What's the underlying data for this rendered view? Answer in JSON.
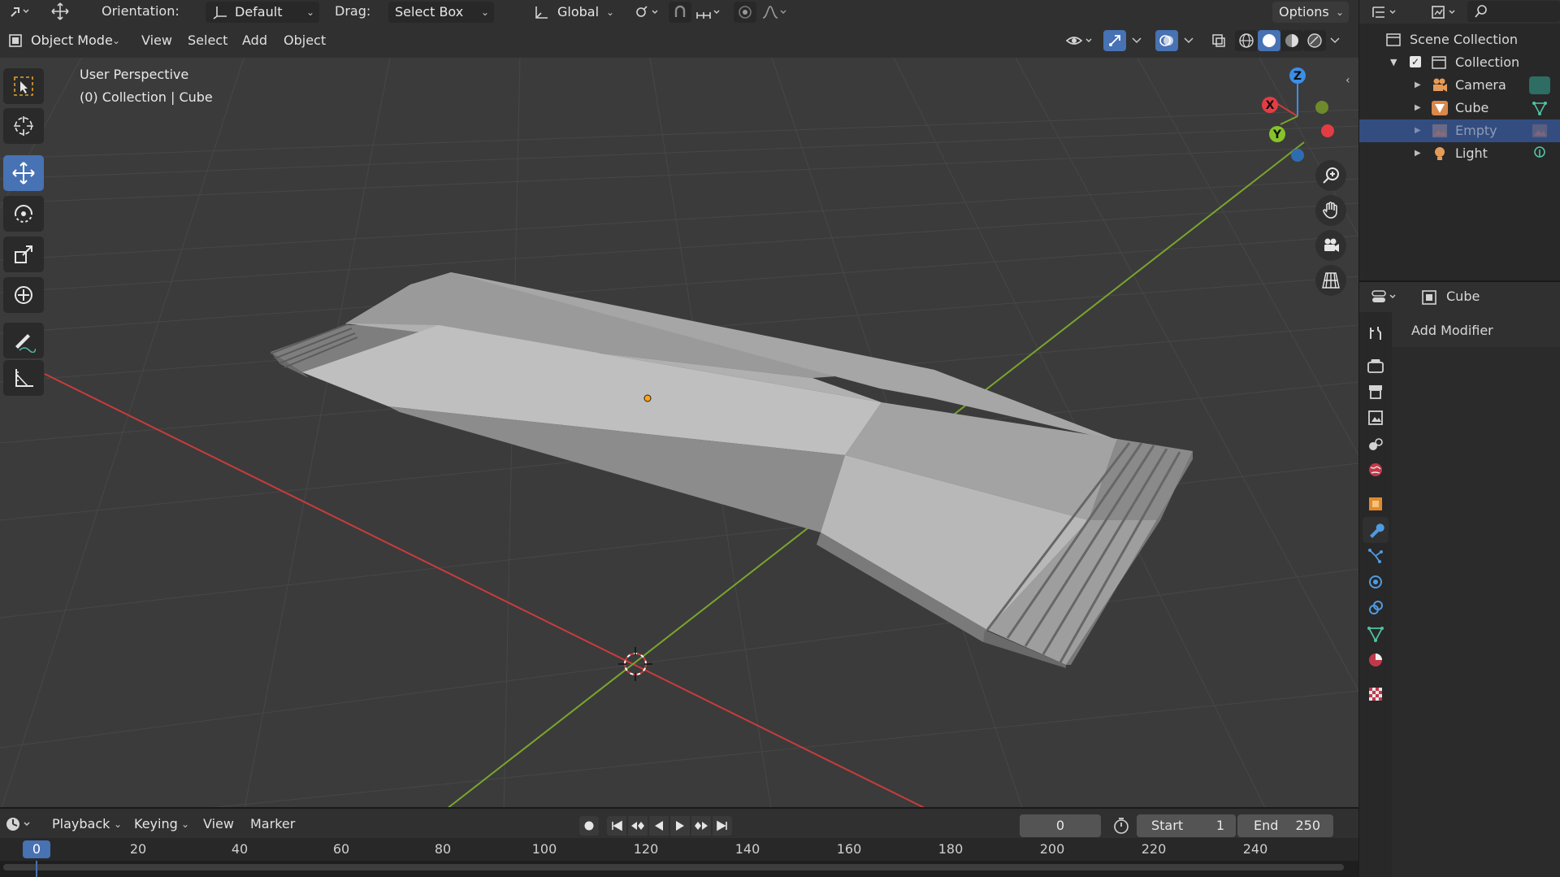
{
  "header": {
    "orientation_label": "Orientation:",
    "orientation_value": "Default",
    "drag_label": "Drag:",
    "drag_value": "Select Box",
    "transform_space": "Global",
    "options_label": "Options"
  },
  "viewport_header": {
    "mode": "Object Mode",
    "menus": [
      "View",
      "Select",
      "Add",
      "Object"
    ]
  },
  "viewport": {
    "perspective": "User Perspective",
    "context": "(0) Collection | Cube",
    "gizmo_axes": {
      "x": "X",
      "y": "Y",
      "z": "Z"
    },
    "colors": {
      "x_axis": "#c83c3c",
      "y_axis": "#7aa62e",
      "origin": "#ffa319"
    }
  },
  "toolbar": {
    "tools": [
      "select-box",
      "cursor",
      "move",
      "rotate",
      "scale",
      "transform",
      "annotate",
      "measure"
    ],
    "active": "move"
  },
  "outliner": {
    "root": "Scene Collection",
    "collection": "Collection",
    "items": [
      {
        "name": "Camera",
        "icon": "camera-icon",
        "selected": false
      },
      {
        "name": "Cube",
        "icon": "mesh-icon",
        "selected": false
      },
      {
        "name": "Empty",
        "icon": "image-empty-icon",
        "selected": true
      },
      {
        "name": "Light",
        "icon": "light-icon",
        "selected": false
      }
    ]
  },
  "properties": {
    "object_name": "Cube",
    "add_modifier": "Add Modifier",
    "active_tab": "modifier"
  },
  "timeline": {
    "menus": [
      "Playback",
      "Keying",
      "View",
      "Marker"
    ],
    "current_frame": "0",
    "start_label": "Start",
    "start_value": "1",
    "end_label": "End",
    "end_value": "250",
    "ruler_current": "0",
    "ruler_ticks": [
      "20",
      "40",
      "60",
      "80",
      "100",
      "120",
      "140",
      "160",
      "180",
      "200",
      "220",
      "240"
    ]
  },
  "accent": "#4772b3"
}
